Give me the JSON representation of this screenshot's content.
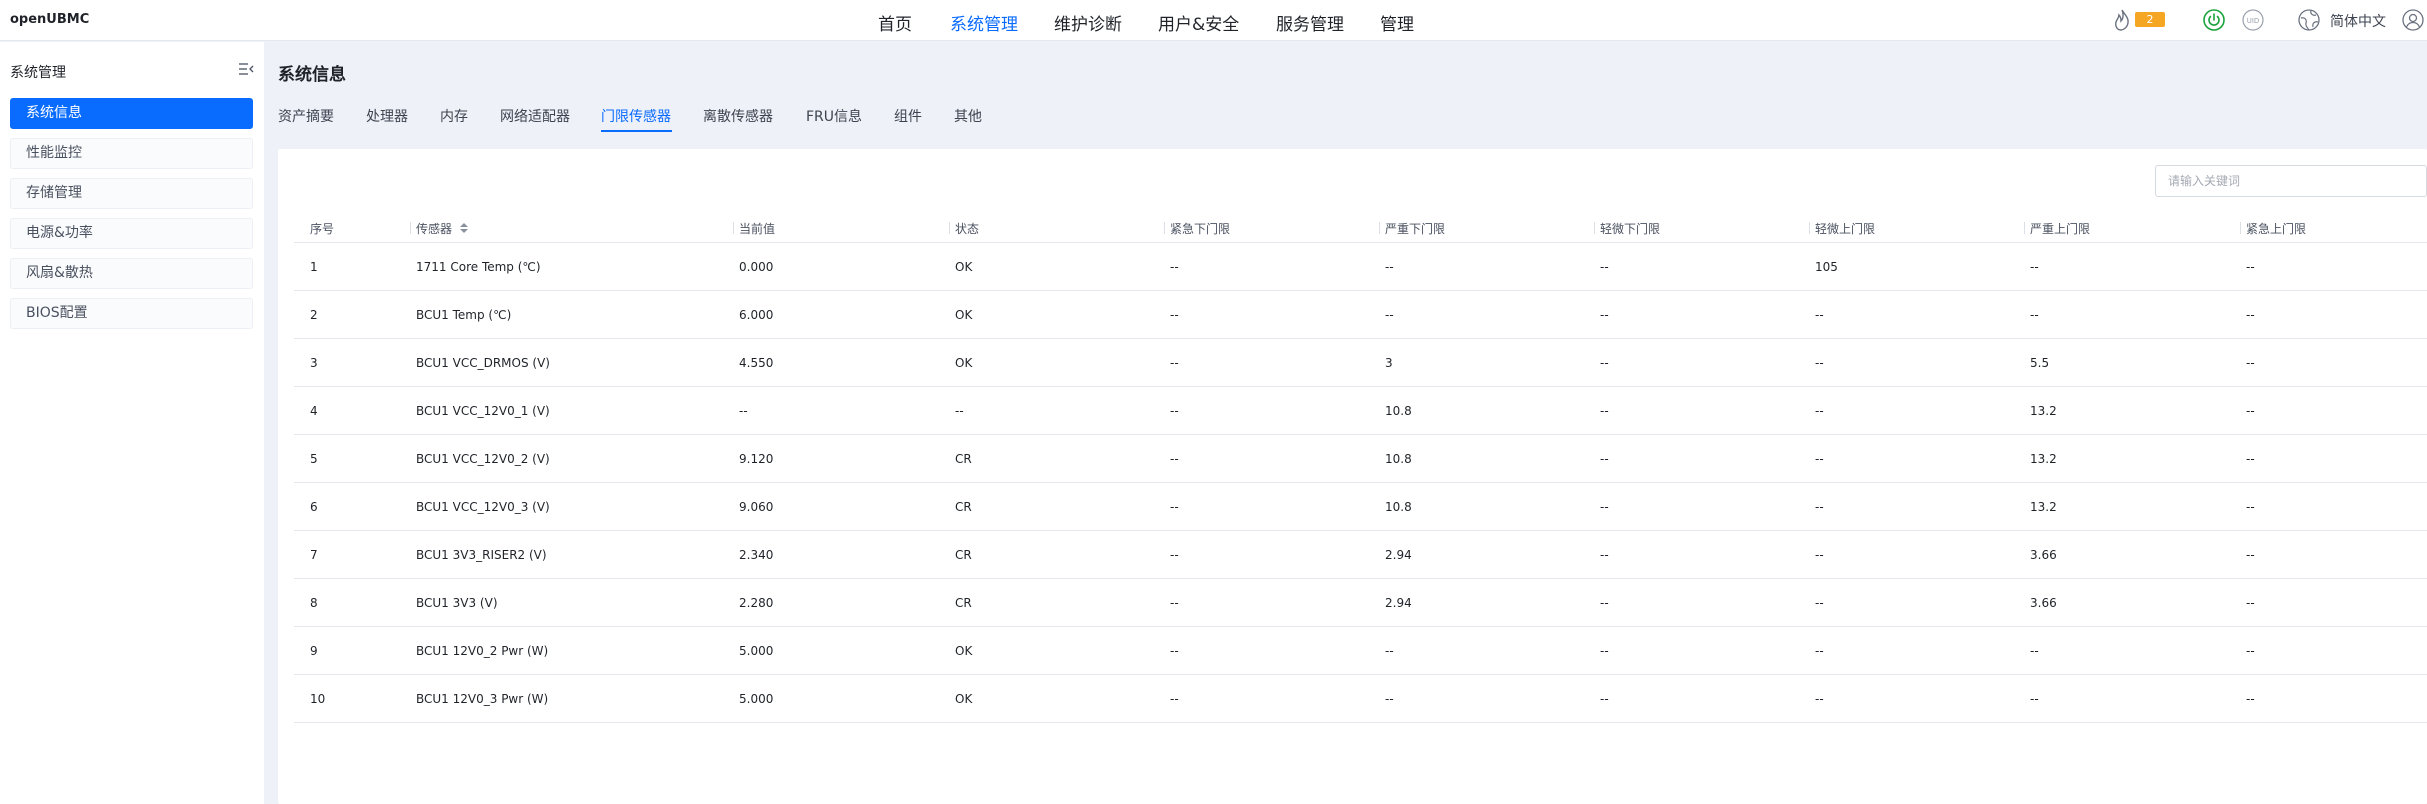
{
  "app": {
    "logo": "openUBMC"
  },
  "nav": {
    "items": [
      "首页",
      "系统管理",
      "维护诊断",
      "用户&安全",
      "服务管理",
      "管理"
    ],
    "active_index": 1
  },
  "header": {
    "alarm_count": "2",
    "language": "简体中文",
    "icons": [
      "alarm-fire-icon",
      "power-icon",
      "uid-icon",
      "network-icon",
      "user-icon"
    ],
    "colors": {
      "badge": "#f5a623",
      "power": "#1aa33b",
      "accent": "#0a6cff"
    }
  },
  "sidebar": {
    "title": "系统管理",
    "items": [
      "系统信息",
      "性能监控",
      "存储管理",
      "电源&功率",
      "风扇&散热",
      "BIOS配置"
    ],
    "active_index": 0
  },
  "main": {
    "title": "系统信息",
    "tabs": [
      "资产摘要",
      "处理器",
      "内存",
      "网络适配器",
      "门限传感器",
      "离散传感器",
      "FRU信息",
      "组件",
      "其他"
    ],
    "active_tab_index": 4,
    "search_placeholder": "请输入关键词"
  },
  "table": {
    "columns": [
      "序号",
      "传感器",
      "当前值",
      "状态",
      "紧急下门限",
      "严重下门限",
      "轻微下门限",
      "轻微上门限",
      "严重上门限",
      "紧急上门限"
    ],
    "sortable_column": "传感器",
    "rows": [
      [
        "1",
        "1711 Core Temp (℃)",
        "0.000",
        "OK",
        "--",
        "--",
        "--",
        "105",
        "--",
        "--"
      ],
      [
        "2",
        "BCU1 Temp (℃)",
        "6.000",
        "OK",
        "--",
        "--",
        "--",
        "--",
        "--",
        "--"
      ],
      [
        "3",
        "BCU1 VCC_DRMOS (V)",
        "4.550",
        "OK",
        "--",
        "3",
        "--",
        "--",
        "5.5",
        "--"
      ],
      [
        "4",
        "BCU1 VCC_12V0_1 (V)",
        "--",
        "--",
        "--",
        "10.8",
        "--",
        "--",
        "13.2",
        "--"
      ],
      [
        "5",
        "BCU1 VCC_12V0_2 (V)",
        "9.120",
        "CR",
        "--",
        "10.8",
        "--",
        "--",
        "13.2",
        "--"
      ],
      [
        "6",
        "BCU1 VCC_12V0_3 (V)",
        "9.060",
        "CR",
        "--",
        "10.8",
        "--",
        "--",
        "13.2",
        "--"
      ],
      [
        "7",
        "BCU1 3V3_RISER2 (V)",
        "2.340",
        "CR",
        "--",
        "2.94",
        "--",
        "--",
        "3.66",
        "--"
      ],
      [
        "8",
        "BCU1 3V3 (V)",
        "2.280",
        "CR",
        "--",
        "2.94",
        "--",
        "--",
        "3.66",
        "--"
      ],
      [
        "9",
        "BCU1 12V0_2 Pwr (W)",
        "5.000",
        "OK",
        "--",
        "--",
        "--",
        "--",
        "--",
        "--"
      ],
      [
        "10",
        "BCU1 12V0_3 Pwr (W)",
        "5.000",
        "OK",
        "--",
        "--",
        "--",
        "--",
        "--",
        "--"
      ]
    ]
  }
}
